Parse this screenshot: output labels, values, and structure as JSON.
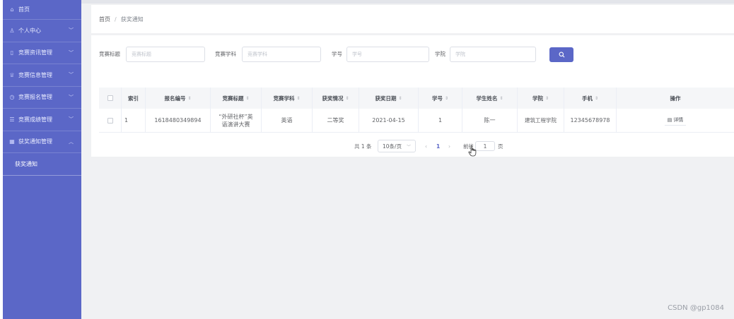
{
  "sidebar": {
    "items": [
      {
        "label": "首页",
        "icon": "home-icon",
        "arrow": ""
      },
      {
        "label": "个人中心",
        "icon": "user-icon",
        "arrow": "﹀"
      },
      {
        "label": "竞赛资讯管理",
        "icon": "info-icon",
        "arrow": "﹀"
      },
      {
        "label": "竞赛信息管理",
        "icon": "trophy-icon",
        "arrow": "﹀"
      },
      {
        "label": "竞赛报名管理",
        "icon": "clock-icon",
        "arrow": "﹀"
      },
      {
        "label": "竞赛成绩管理",
        "icon": "list-icon",
        "arrow": "﹀"
      },
      {
        "label": "获奖通知管理",
        "icon": "grid-icon",
        "arrow": "︿"
      }
    ],
    "sub_item": "获奖通知"
  },
  "breadcrumb": {
    "home": "首页",
    "separator": "/",
    "current": "获奖通知"
  },
  "search": {
    "title_label": "竞赛标题",
    "title_placeholder": "竞赛标题",
    "subject_label": "竞赛学科",
    "subject_placeholder": "竞赛学科",
    "id_label": "学号",
    "id_placeholder": "学号",
    "college_label": "学院",
    "college_placeholder": "学院"
  },
  "table": {
    "headers": [
      "索引",
      "报名编号",
      "竞赛标题",
      "竞赛学科",
      "获奖情况",
      "获奖日期",
      "学号",
      "学生姓名",
      "学院",
      "手机",
      "操作"
    ],
    "rows": [
      {
        "index": "1",
        "reg_no": "1618480349894",
        "title": "“外研社杯”英语演讲大赛",
        "subject": "英语",
        "award": "二等奖",
        "date": "2021-04-15",
        "student_id": "1",
        "name": "陈一",
        "college": "建筑工程学院",
        "phone": "12345678978",
        "action": "详情"
      }
    ]
  },
  "pagination": {
    "total": "共 1 条",
    "page_size": "10条/页",
    "current_page": "1",
    "goto_label": "前往",
    "goto_value": "1",
    "page_unit": "页"
  },
  "watermark": "CSDN @gp1084",
  "colors": {
    "sidebar": "#5b67c7",
    "accent": "#5b67c7"
  }
}
